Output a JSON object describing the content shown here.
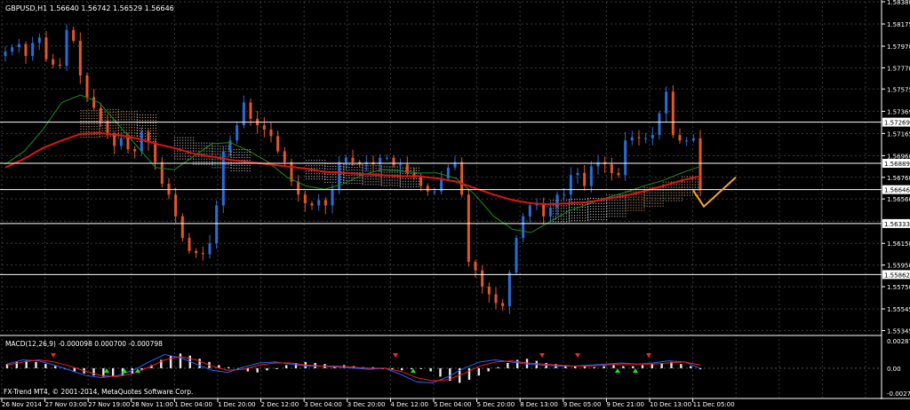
{
  "window": {
    "symbol_info": "GBPUSD,H1  1.56640 1.56742 1.56529 1.56646",
    "macd_label": "MACD(12,26,9) -0.000098 0.000700 -0.000798",
    "copyright": "FX-Trend MT4, © 2001-2014, MetaQuotes Software Corp."
  },
  "colors": {
    "background": "#000000",
    "grid": "#3a3a3a",
    "bull_candle": "#2a6cd6",
    "bear_candle": "#e2562a",
    "ma_red": "#e01414",
    "ma_green": "#1e8c1e",
    "cloud_bull": "#e6b48a",
    "cloud_bear": "#d8d8d8",
    "forecast": "#f5a623",
    "hline": "#ffffff",
    "macd_hist": "#e8e8e8",
    "macd_blue": "#1e64ff",
    "macd_red": "#ff1a1a",
    "arrow_green": "#22dd22",
    "arrow_red": "#ff2222"
  },
  "price_axis": {
    "labels": [
      "1.58380",
      "1.58175",
      "1.57970",
      "1.57770",
      "1.57575",
      "1.57369",
      "1.57165",
      "1.56960",
      "1.56760",
      "1.56560",
      "1.56355",
      "1.56150",
      "1.55950",
      "1.55750",
      "1.55545",
      "1.55345"
    ],
    "highlighted": [
      "1.57269",
      "1.56889",
      "1.56646",
      "1.56333",
      "1.55862"
    ]
  },
  "macd_axis": {
    "labels": [
      "0.00287",
      "0.00",
      "-0.002799"
    ]
  },
  "time_axis": {
    "labels": [
      "26 Nov 2014",
      "27 Nov 03:00",
      "27 Nov 19:00",
      "28 Nov 11:00",
      "1 Dec 04:00",
      "1 Dec 20:00",
      "2 Dec 12:00",
      "3 Dec 04:00",
      "3 Dec 20:00",
      "4 Dec 12:00",
      "5 Dec 04:00",
      "5 Dec 20:00",
      "8 Dec 13:00",
      "9 Dec 05:00",
      "9 Dec 21:00",
      "10 Dec 13:00",
      "11 Dec 05:00"
    ]
  },
  "chart_data": {
    "type": "candlestick",
    "symbol": "GBPUSD",
    "timeframe": "H1",
    "ylim": [
      1.553,
      1.5838
    ],
    "ohlc_last": {
      "open": "1.56640",
      "high": "1.56742",
      "low": "1.56529",
      "close": "1.56646"
    },
    "close_path": [
      1.5792,
      1.5796,
      1.5799,
      1.5788,
      1.58,
      1.5805,
      1.5785,
      1.578,
      1.5779,
      1.5812,
      1.5802,
      1.577,
      1.575,
      1.574,
      1.5728,
      1.5715,
      1.5705,
      1.5712,
      1.5702,
      1.57,
      1.5718,
      1.5708,
      1.569,
      1.567,
      1.566,
      1.564,
      1.562,
      1.5608,
      1.5606,
      1.5605,
      1.5615,
      1.565,
      1.57,
      1.571,
      1.5724,
      1.5745,
      1.573,
      1.5724,
      1.572,
      1.5714,
      1.57,
      1.569,
      1.5672,
      1.566,
      1.5652,
      1.565,
      1.5655,
      1.565,
      1.5665,
      1.569,
      1.5694,
      1.569,
      1.5688,
      1.569,
      1.5688,
      1.5694,
      1.5694,
      1.5687,
      1.5688,
      1.568,
      1.5676,
      1.5668,
      1.5663,
      1.5663,
      1.5675,
      1.5685,
      1.569,
      1.566,
      1.5598,
      1.559,
      1.5575,
      1.5568,
      1.556,
      1.5557,
      1.5588,
      1.562,
      1.564,
      1.565,
      1.5652,
      1.564,
      1.5648,
      1.566,
      1.566,
      1.5678,
      1.568,
      1.5668,
      1.5686,
      1.569,
      1.5688,
      1.568,
      1.5678,
      1.571,
      1.5713,
      1.5712,
      1.5712,
      1.5715,
      1.5735,
      1.5755,
      1.5715,
      1.571,
      1.571,
      1.5712,
      1.5664
    ],
    "ma_red": [
      1.5685,
      1.5693,
      1.5703,
      1.571,
      1.5716,
      1.5717,
      1.5715,
      1.5712,
      1.5707,
      1.5703,
      1.5698,
      1.5695,
      1.5692,
      1.569,
      1.5688,
      1.5686,
      1.5684,
      1.5681,
      1.568,
      1.5679,
      1.5678,
      1.5677,
      1.5677,
      1.5675,
      1.5672,
      1.5666,
      1.566,
      1.5655,
      1.5652,
      1.5651,
      1.5652,
      1.5653,
      1.5656,
      1.5659,
      1.5663,
      1.5668,
      1.5673,
      1.5677
    ],
    "ma_green": [
      1.5688,
      1.57,
      1.572,
      1.5745,
      1.5752,
      1.5745,
      1.5725,
      1.5705,
      1.5685,
      1.5683,
      1.5695,
      1.5707,
      1.5708,
      1.57,
      1.569,
      1.5676,
      1.5668,
      1.5665,
      1.567,
      1.5678,
      1.5683,
      1.5682,
      1.568,
      1.568,
      1.5675,
      1.566,
      1.564,
      1.5628,
      1.5625,
      1.5635,
      1.5645,
      1.5651,
      1.5657,
      1.5662,
      1.5668,
      1.5673,
      1.568,
      1.5686
    ],
    "forecast": [
      1.5664,
      1.5649,
      1.5676
    ],
    "horizontal_levels": [
      1.57269,
      1.56889,
      1.56646,
      1.56333,
      1.55862
    ],
    "macd": {
      "range": [
        -0.002799,
        0.00287
      ],
      "histogram": [
        0.0004,
        0.0006,
        0.0007,
        0.0006,
        0.0004,
        0.0002,
        -0.0001,
        -0.0003,
        -0.0005,
        -0.0007,
        -0.0008,
        -0.0008,
        -0.0007,
        -0.0005,
        -0.0002,
        0.0003,
        0.0008,
        0.0012,
        0.0014,
        0.0012,
        0.0009,
        0.0006,
        0.0003,
        0.0001,
        -0.0001,
        -0.0003,
        -0.0004,
        -0.0002,
        0.0,
        0.0003,
        0.0005,
        0.0006,
        0.0005,
        0.0004,
        0.0002,
        0.0003,
        0.0002,
        0.0001,
        0.0001,
        0.0,
        -0.0001,
        -0.0002,
        -0.0001,
        0.0,
        -0.0003,
        -0.0008,
        -0.0012,
        -0.0014,
        -0.0011,
        -0.0007,
        -0.0003,
        0.0001,
        0.0005,
        0.0008,
        0.0009,
        0.0007,
        0.0005,
        0.0004,
        0.0003,
        0.0002,
        0.0002,
        0.0001,
        0.0002,
        0.0003,
        0.0002,
        0.0002,
        0.0003,
        0.0004,
        0.0005,
        0.0006,
        0.0004,
        0.0002,
        -0.0001
      ],
      "signal_blue": [
        0.0004,
        0.0008,
        0.0007,
        0.0003,
        -0.0002,
        -0.0007,
        -0.0009,
        -0.0007,
        -0.0002,
        0.0006,
        0.0013,
        0.001,
        0.0004,
        -0.0002,
        -0.0004,
        0.0001,
        0.0005,
        0.0006,
        0.0004,
        0.0002,
        0.0002,
        0.0001,
        0.0,
        -0.0001,
        0.0,
        -0.0006,
        -0.0013,
        -0.0014,
        -0.0008,
        0.0,
        0.0006,
        0.0008,
        0.0006,
        0.0004,
        0.0003,
        0.0002,
        0.0002,
        0.0003,
        0.0004,
        0.0005,
        0.0004,
        0.0005,
        0.0007,
        0.0006,
        0.0
      ],
      "signal_red": [
        0.0003,
        0.0006,
        0.0008,
        0.0006,
        0.0002,
        -0.0003,
        -0.0007,
        -0.0008,
        -0.0005,
        0.0001,
        0.0008,
        0.0011,
        0.0008,
        0.0002,
        -0.0002,
        -0.0001,
        0.0003,
        0.0005,
        0.0005,
        0.0003,
        0.0002,
        0.0002,
        0.0001,
        0.0,
        0.0,
        -0.0003,
        -0.0009,
        -0.0012,
        -0.0011,
        -0.0005,
        0.0002,
        0.0006,
        0.0007,
        0.0005,
        0.0004,
        0.0003,
        0.0002,
        0.0002,
        0.0003,
        0.0004,
        0.0004,
        0.0004,
        0.0005,
        0.0006,
        0.0003
      ]
    }
  }
}
